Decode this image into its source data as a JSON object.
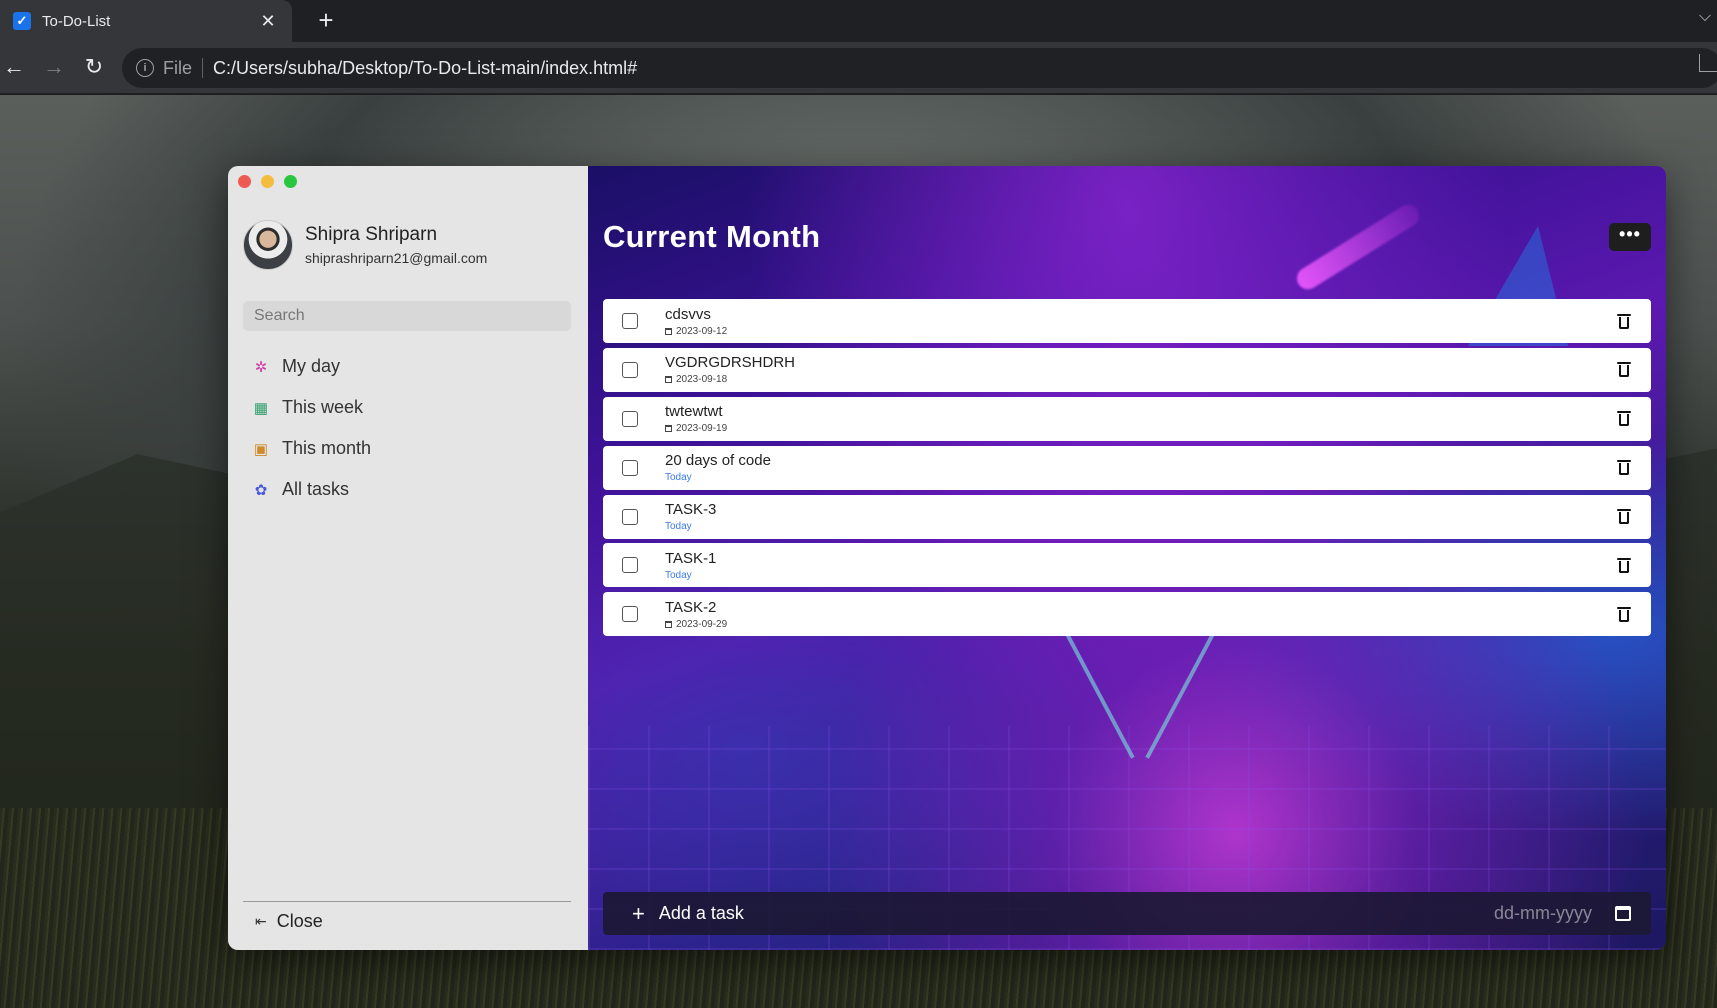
{
  "browser": {
    "tab_title": "To-Do-List",
    "address_scheme": "File",
    "address_url": "C:/Users/subha/Desktop/To-Do-List-main/index.html#"
  },
  "user": {
    "name": "Shipra Shriparn",
    "email": "shiprashriparn21@gmail.com"
  },
  "sidebar": {
    "search_placeholder": "Search",
    "items": [
      {
        "label": "My day",
        "icon": "sun-icon",
        "color": "#d63da8"
      },
      {
        "label": "This week",
        "icon": "grid-icon",
        "color": "#2e9e6a"
      },
      {
        "label": "This month",
        "icon": "calendar-icon",
        "color": "#d08a2a"
      },
      {
        "label": "All tasks",
        "icon": "puzzle-icon",
        "color": "#4a5bd8"
      }
    ],
    "close_label": "Close"
  },
  "main": {
    "title": "Current Month",
    "tasks": [
      {
        "name": "cdsvvs",
        "date": "2023-09-12"
      },
      {
        "name": "VGDRGDRSHDRH",
        "date": "2023-09-18"
      },
      {
        "name": "twtewtwt",
        "date": "2023-09-19"
      },
      {
        "name": "20 days of code",
        "date": "Today"
      },
      {
        "name": "TASK-3",
        "date": "Today"
      },
      {
        "name": "TASK-1",
        "date": "Today"
      },
      {
        "name": "TASK-2",
        "date": "2023-09-29"
      }
    ],
    "add_task_placeholder": "Add a task",
    "date_placeholder": "dd-mm-yyyy"
  }
}
